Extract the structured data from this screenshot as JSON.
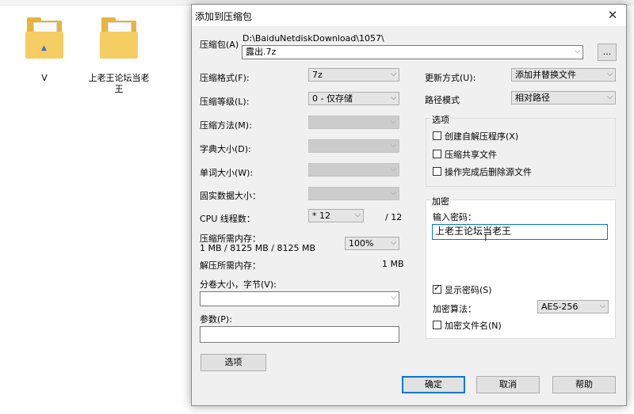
{
  "desktop": {
    "items": [
      {
        "label": "V"
      },
      {
        "label": "上老王论坛当老王"
      }
    ]
  },
  "dialog": {
    "title": "添加到压缩包",
    "archive": {
      "label": "压缩包(A)",
      "path": "D:\\BaiduNetdiskDownload\\1057\\",
      "filename": "露出.7z",
      "browse_label": "..."
    },
    "left": {
      "format": {
        "label": "压缩格式(F):",
        "value": "7z"
      },
      "level": {
        "label": "压缩等级(L):",
        "value": "0 - 仅存储"
      },
      "method": {
        "label": "压缩方法(M):",
        "value": ""
      },
      "dict": {
        "label": "字典大小(D):",
        "value": ""
      },
      "word": {
        "label": "单词大小(W):",
        "value": ""
      },
      "solid": {
        "label": "固实数据大小：",
        "value": ""
      },
      "threads": {
        "label": "CPU 线程数：",
        "value": "* 12",
        "max": "/ 12"
      },
      "mem_compress": {
        "label": "压缩所需内存：",
        "detail": "1 MB / 8125 MB / 8125 MB",
        "value": "100%"
      },
      "mem_decompress": {
        "label": "解压所需内存：",
        "value": "1 MB"
      },
      "split": {
        "label": "分卷大小，字节(V):",
        "value": ""
      },
      "params": {
        "label": "参数(P):",
        "value": ""
      },
      "options_button": "选项"
    },
    "right": {
      "update": {
        "label": "更新方式(U):",
        "value": "添加并替换文件"
      },
      "path_mode": {
        "label": "路径模式",
        "value": "相对路径"
      },
      "options": {
        "title": "选项",
        "sfx": "创建自解压程序(X)",
        "shared": "压缩共享文件",
        "delete": "操作完成后删除源文件"
      },
      "encryption": {
        "title": "加密",
        "password_label": "输入密码：",
        "password_value": "上老王论坛当老王",
        "show_password": "显示密码(S)",
        "method_label": "加密算法：",
        "method_value": "AES-256",
        "encrypt_names": "加密文件名(N)"
      }
    },
    "buttons": {
      "ok": "确定",
      "cancel": "取消",
      "help": "帮助"
    }
  }
}
